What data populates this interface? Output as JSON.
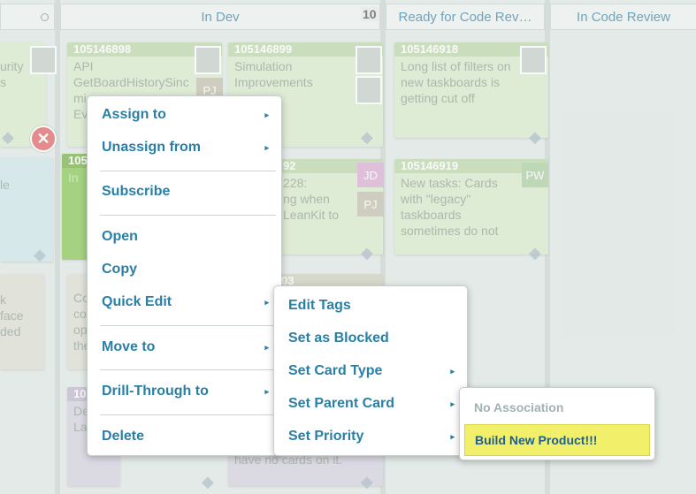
{
  "board": {
    "lanes": [
      {
        "title": "",
        "wip": ""
      },
      {
        "title": "In Dev",
        "wip": "10"
      },
      {
        "title": "Ready for Code Rev…",
        "wip": ""
      },
      {
        "title": "In Code Review",
        "wip": ""
      }
    ],
    "cards": {
      "c0": {
        "id": "",
        "text": "urity\ns"
      },
      "c1": {
        "id": "105146898",
        "text": "API\nGetBoardHistorySinc\nmi\nEv"
      },
      "c2": {
        "id": "105146899",
        "text": "Simulation\nImprovements"
      },
      "c3": {
        "id": "105146918",
        "text": "Long list of filters on\nnew taskboards is\ngetting cut off"
      },
      "c4": {
        "id": "",
        "text": "le"
      },
      "c5": {
        "id": "105",
        "text": "In"
      },
      "c6": {
        "id": "92",
        "text": "228:\nng when\nLeanKit to"
      },
      "c7": {
        "id": "105146919",
        "text": "New tasks: Cards\nwith \"legacy\"\ntaskboards\nsometimes do not"
      },
      "c8": {
        "id": "",
        "text": "k\nface\nded"
      },
      "c9": {
        "id": "",
        "text": "Co\nco\nop\nthe"
      },
      "c10": {
        "id": "03",
        "text": ""
      },
      "c11": {
        "id": "105",
        "text": "De\nLa"
      },
      "c12": {
        "id": "",
        "text": "have no cards on it."
      }
    },
    "initials": {
      "jd": "JD",
      "pj": "PJ",
      "pj2": "PJ",
      "pw": "PW"
    }
  },
  "context_menu": {
    "items": {
      "assign_to": "Assign to",
      "unassign_from": "Unassign from",
      "subscribe": "Subscribe",
      "open": "Open",
      "copy": "Copy",
      "quick_edit": "Quick Edit",
      "move_to": "Move to",
      "drill_through": "Drill-Through to",
      "delete": "Delete"
    },
    "arrow_glyph": "▸"
  },
  "quick_edit_menu": {
    "items": {
      "edit_tags": "Edit Tags",
      "set_as_blocked": "Set as Blocked",
      "set_card_type": "Set Card Type",
      "set_parent_card": "Set Parent Card",
      "set_priority": "Set Priority"
    }
  },
  "parent_card_menu": {
    "items": {
      "no_association": "No Association",
      "build_new_product": "Build New Product!!!"
    }
  },
  "colors": {
    "menu_text": "#2a7fa5",
    "highlight": "#f2f06b",
    "header_text": "#2e7ba0"
  }
}
